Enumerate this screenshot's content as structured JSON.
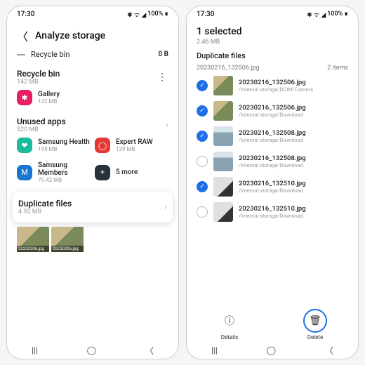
{
  "status": {
    "time": "17:30",
    "battery": "100%"
  },
  "left": {
    "title": "Analyze storage",
    "top_row": {
      "label": "Recycle bin",
      "value": "0 B"
    },
    "recycle": {
      "name": "Recycle bin",
      "size": "142 MB",
      "app": {
        "name": "Gallery",
        "size": "142 MB"
      }
    },
    "unused": {
      "name": "Unused apps",
      "size": "520 MB",
      "apps": [
        {
          "name": "Samsung Health",
          "size": "195 MB"
        },
        {
          "name": "Expert RAW",
          "size": "129 MB"
        },
        {
          "name": "Samsung Members",
          "size": "79.42 MB"
        },
        {
          "name": "5 more",
          "size": ""
        }
      ]
    },
    "dup": {
      "name": "Duplicate files",
      "size": "4.92 MB",
      "thumb_label": "20230206.jpg"
    }
  },
  "right": {
    "selected": "1 selected",
    "selected_size": "2.46 MB",
    "section": "Duplicate files",
    "group": {
      "name": "20230216_132506.jpg",
      "count": "2 items"
    },
    "files": [
      {
        "name": "20230216_132506.jpg",
        "path": "/Internal storage/DCIM/Camera",
        "checked": true,
        "thumb": "food"
      },
      {
        "name": "20230216_132506.jpg",
        "path": "/Internal storage/Download",
        "checked": true,
        "thumb": "food"
      },
      {
        "name": "20230216_132508.jpg",
        "path": "/Internal storage/Download",
        "checked": true,
        "thumb": "window"
      },
      {
        "name": "20230216_132508.jpg",
        "path": "/Internal storage/Download",
        "checked": false,
        "thumb": "window"
      },
      {
        "name": "20230216_132510.jpg",
        "path": "/Internal storage/Download",
        "checked": true,
        "thumb": "dark"
      },
      {
        "name": "20230216_132510.jpg",
        "path": "/Internal storage/Download",
        "checked": false,
        "thumb": "dark"
      }
    ],
    "actions": {
      "details": "Details",
      "delete": "Delete"
    }
  }
}
